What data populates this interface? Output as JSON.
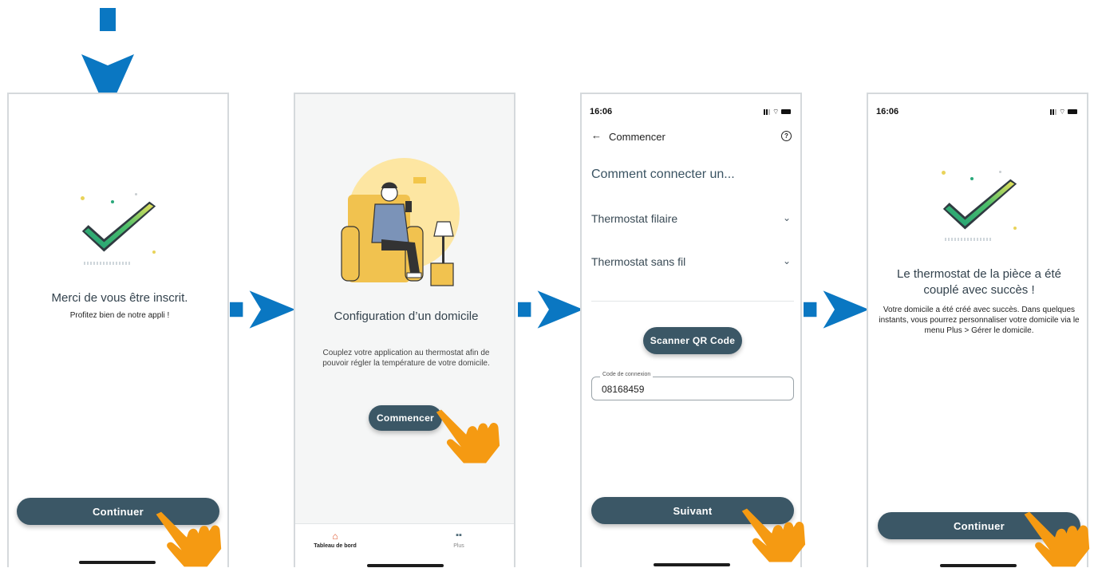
{
  "screen1": {
    "title": "Merci de vous être inscrit.",
    "subtitle": "Profitez bien de notre appli !",
    "button": "Continuer"
  },
  "screen2": {
    "title": "Configuration d’un domicile",
    "description": "Couplez votre application au thermostat afin de pouvoir régler la température de votre domicile.",
    "button": "Commencer",
    "nav": [
      {
        "label": "Tableau de bord",
        "icon": "home-icon"
      },
      {
        "label": "Plus",
        "icon": "grid-icon"
      }
    ]
  },
  "screen3": {
    "time": "16:06",
    "header_title": "Commencer",
    "heading": "Comment connecter un...",
    "options": [
      "Thermostat filaire",
      "Thermostat sans fil"
    ],
    "scan_button": "Scanner QR Code",
    "code_label": "Code de connexion",
    "code_value": "08168459",
    "next_button": "Suivant"
  },
  "screen4": {
    "time": "16:06",
    "title": "Le thermostat de la pièce a été couplé avec succès !",
    "description": "Votre domicile a été créé avec succès. Dans quelques instants, vous pourrez personnaliser votre domicile via le menu Plus > Gérer le domicile.",
    "button": "Continuer"
  },
  "colors": {
    "accent": "#0a77c2",
    "button": "#3b5766",
    "hand": "#f59a12"
  }
}
